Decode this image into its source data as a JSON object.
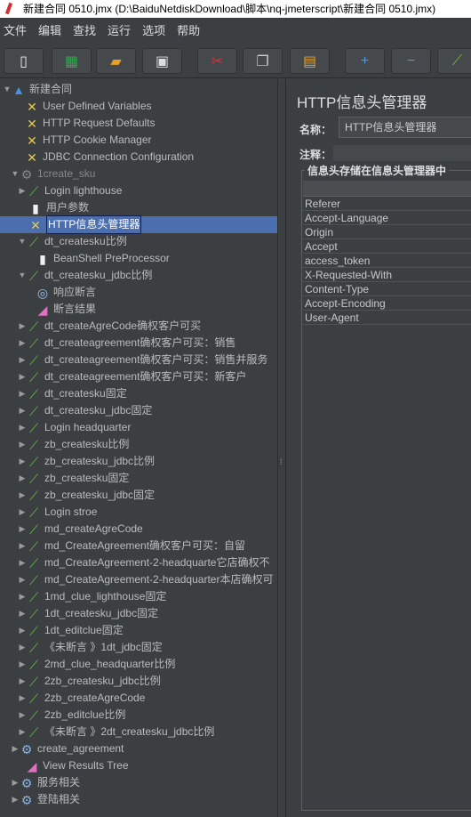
{
  "window_title": "新建合同 0510.jmx (D:\\BaiduNetdiskDownload\\脚本\\nq-jmeterscript\\新建合同 0510.jmx)",
  "menu": [
    "文件",
    "编辑",
    "查找",
    "运行",
    "选项",
    "帮助"
  ],
  "toolbar": [
    {
      "icon": "new-icon",
      "glyph": "▯",
      "color": "#f2f2f2"
    },
    {
      "icon": "templates-icon",
      "glyph": "▦",
      "color": "#2fa84f"
    },
    {
      "icon": "open-icon",
      "glyph": "▰",
      "color": "#e8a020"
    },
    {
      "icon": "save-icon",
      "glyph": "▣",
      "color": "#dddddd"
    },
    {
      "icon": "cut-icon",
      "glyph": "✂",
      "color": "#e03030"
    },
    {
      "icon": "copy-icon",
      "glyph": "❐",
      "color": "#cccccc"
    },
    {
      "icon": "paste-icon",
      "glyph": "▤",
      "color": "#d9a040"
    },
    {
      "icon": "expand-icon",
      "glyph": "+",
      "color": "#4a9be8"
    },
    {
      "icon": "collapse-icon",
      "glyph": "−",
      "color": "#4a9be8"
    },
    {
      "icon": "toggle-icon",
      "glyph": "⟋",
      "color": "#6bbf4a"
    }
  ],
  "tree": [
    {
      "label": "新建合同",
      "level": 0,
      "toggle": "open",
      "icon": "flask"
    },
    {
      "label": "User Defined Variables",
      "level": 1,
      "toggle": "",
      "icon": "config"
    },
    {
      "label": "HTTP Request Defaults",
      "level": 1,
      "toggle": "",
      "icon": "config"
    },
    {
      "label": "HTTP Cookie Manager",
      "level": 1,
      "toggle": "",
      "icon": "config"
    },
    {
      "label": "JDBC Connection Configuration",
      "level": 1,
      "toggle": "",
      "icon": "config"
    },
    {
      "label": "1create_sku",
      "level": 1,
      "toggle": "open",
      "icon": "gear-disabled",
      "disabled": true
    },
    {
      "label": "Login lighthouse",
      "level": 2,
      "toggle": "closed",
      "icon": "sampler"
    },
    {
      "label": "用户参数",
      "level": 2,
      "toggle": "",
      "icon": "preprocessor"
    },
    {
      "label": "HTTP信息头管理器",
      "level": 2,
      "toggle": "",
      "icon": "config",
      "selected": true
    },
    {
      "label": "dt_createsku比例",
      "level": 2,
      "toggle": "open",
      "icon": "sampler"
    },
    {
      "label": "BeanShell PreProcessor",
      "level": 3,
      "toggle": "",
      "icon": "preprocessor"
    },
    {
      "label": "dt_createsku_jdbc比例",
      "level": 2,
      "toggle": "open",
      "icon": "sampler"
    },
    {
      "label": "响应断言",
      "level": 3,
      "toggle": "",
      "icon": "assertion"
    },
    {
      "label": "断言结果",
      "level": 3,
      "toggle": "",
      "icon": "listener"
    },
    {
      "label": "dt_createAgreCode确权客户可买",
      "level": 2,
      "toggle": "closed",
      "icon": "sampler"
    },
    {
      "label": "dt_createagreement确权客户可买：销售",
      "level": 2,
      "toggle": "closed",
      "icon": "sampler"
    },
    {
      "label": "dt_createagreement确权客户可买：销售并服务",
      "level": 2,
      "toggle": "closed",
      "icon": "sampler"
    },
    {
      "label": "dt_createagreement确权客户可买：新客户",
      "level": 2,
      "toggle": "closed",
      "icon": "sampler"
    },
    {
      "label": "dt_createsku固定",
      "level": 2,
      "toggle": "closed",
      "icon": "sampler"
    },
    {
      "label": "dt_createsku_jdbc固定",
      "level": 2,
      "toggle": "closed",
      "icon": "sampler"
    },
    {
      "label": "Login headquarter",
      "level": 2,
      "toggle": "closed",
      "icon": "sampler"
    },
    {
      "label": "zb_createsku比例",
      "level": 2,
      "toggle": "closed",
      "icon": "sampler"
    },
    {
      "label": "zb_createsku_jdbc比例",
      "level": 2,
      "toggle": "closed",
      "icon": "sampler"
    },
    {
      "label": "zb_createsku固定",
      "level": 2,
      "toggle": "closed",
      "icon": "sampler"
    },
    {
      "label": "zb_createsku_jdbc固定",
      "level": 2,
      "toggle": "closed",
      "icon": "sampler"
    },
    {
      "label": "Login stroe",
      "level": 2,
      "toggle": "closed",
      "icon": "sampler"
    },
    {
      "label": "md_createAgreCode",
      "level": 2,
      "toggle": "closed",
      "icon": "sampler"
    },
    {
      "label": "md_CreateAgreement确权客户可买：自留",
      "level": 2,
      "toggle": "closed",
      "icon": "sampler"
    },
    {
      "label": "md_CreateAgreement-2-headquarte它店确权不",
      "level": 2,
      "toggle": "closed",
      "icon": "sampler"
    },
    {
      "label": "md_CreateAgreement-2-headquarter本店确权可",
      "level": 2,
      "toggle": "closed",
      "icon": "sampler"
    },
    {
      "label": "1md_clue_lighthouse固定",
      "level": 2,
      "toggle": "closed",
      "icon": "sampler"
    },
    {
      "label": "1dt_createsku_jdbc固定",
      "level": 2,
      "toggle": "closed",
      "icon": "sampler"
    },
    {
      "label": "1dt_editclue固定",
      "level": 2,
      "toggle": "closed",
      "icon": "sampler"
    },
    {
      "label": "《未断言 》1dt_jdbc固定",
      "level": 2,
      "toggle": "closed",
      "icon": "sampler"
    },
    {
      "label": "2md_clue_headquarter比例",
      "level": 2,
      "toggle": "closed",
      "icon": "sampler"
    },
    {
      "label": "2zb_createsku_jdbc比例",
      "level": 2,
      "toggle": "closed",
      "icon": "sampler"
    },
    {
      "label": "2zb_createAgreCode",
      "level": 2,
      "toggle": "closed",
      "icon": "sampler"
    },
    {
      "label": "2zb_editclue比例",
      "level": 2,
      "toggle": "closed",
      "icon": "sampler"
    },
    {
      "label": "《未断言 》2dt_createsku_jdbc比例",
      "level": 2,
      "toggle": "closed",
      "icon": "sampler"
    },
    {
      "label": "create_agreement",
      "level": 1,
      "toggle": "closed",
      "icon": "gear"
    },
    {
      "label": "View Results Tree",
      "level": 1,
      "toggle": "",
      "icon": "listener"
    },
    {
      "label": "服务相关",
      "level": 1,
      "toggle": "closed",
      "icon": "gear"
    },
    {
      "label": "登陆相关",
      "level": 1,
      "toggle": "closed",
      "icon": "gear"
    }
  ],
  "panel": {
    "title": "HTTP信息头管理器",
    "name_label": "名称：",
    "name_value": "HTTP信息头管理器",
    "comment_label": "注释：",
    "group_label": "信息头存储在信息头管理器中",
    "headers": [
      "Referer",
      "Accept-Language",
      "Origin",
      "Accept",
      "access_token",
      "X-Requested-With",
      "Content-Type",
      "Accept-Encoding",
      "User-Agent"
    ]
  }
}
